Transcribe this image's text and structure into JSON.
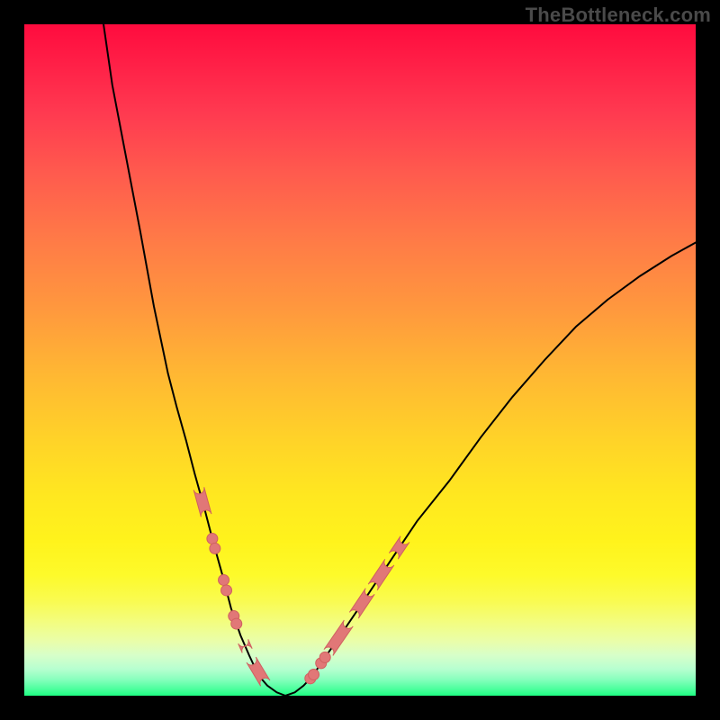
{
  "watermark": "TheBottleneck.com",
  "chart_data": {
    "type": "line",
    "title": "",
    "xlabel": "",
    "ylabel": "",
    "xlim": [
      0,
      100
    ],
    "ylim": [
      0,
      100
    ],
    "grid": false,
    "left_segments_x_pct": [
      26.0,
      27.1,
      28.0,
      28.4,
      29.7,
      30.1,
      31.2,
      31.6,
      32.6,
      33.2,
      33.8,
      35.9
    ],
    "colors": {
      "curve": "#000000",
      "segment_fill": "#e17777",
      "segment_stroke": "#d06060",
      "gradient_top": "#ff0b3e",
      "gradient_bottom": "#1eff82"
    },
    "series": [
      {
        "name": "left_branch",
        "x": [
          11.8,
          13.1,
          15.2,
          17.3,
          19.3,
          21.4,
          22.7,
          24.1,
          25.4,
          26.8,
          28.1,
          29.5,
          30.8,
          32.2,
          33.5,
          34.9,
          36.2,
          37.6,
          38.9
        ],
        "y": [
          100.0,
          91.0,
          80.0,
          69.0,
          58.0,
          48.0,
          43.0,
          38.0,
          33.0,
          28.0,
          23.0,
          18.0,
          13.0,
          9.0,
          6.0,
          3.0,
          1.5,
          0.5,
          0.0
        ]
      },
      {
        "name": "right_branch",
        "x": [
          38.9,
          40.3,
          41.6,
          43.0,
          44.3,
          46.4,
          49.8,
          53.8,
          58.5,
          63.3,
          68.0,
          72.7,
          77.5,
          82.2,
          86.9,
          91.7,
          96.4,
          100.0
        ],
        "y": [
          0.0,
          0.5,
          1.5,
          3.0,
          5.0,
          8.0,
          13.0,
          19.0,
          26.0,
          32.0,
          38.5,
          44.5,
          50.0,
          55.0,
          59.0,
          62.5,
          65.5,
          67.5
        ]
      }
    ],
    "right_segments_x_pct": [
      42.6,
      43.1,
      44.2,
      44.8,
      45.3,
      48.3,
      49.1,
      51.5,
      51.9,
      54.4,
      55.0,
      56.7
    ],
    "segment_radius_px": 6
  }
}
